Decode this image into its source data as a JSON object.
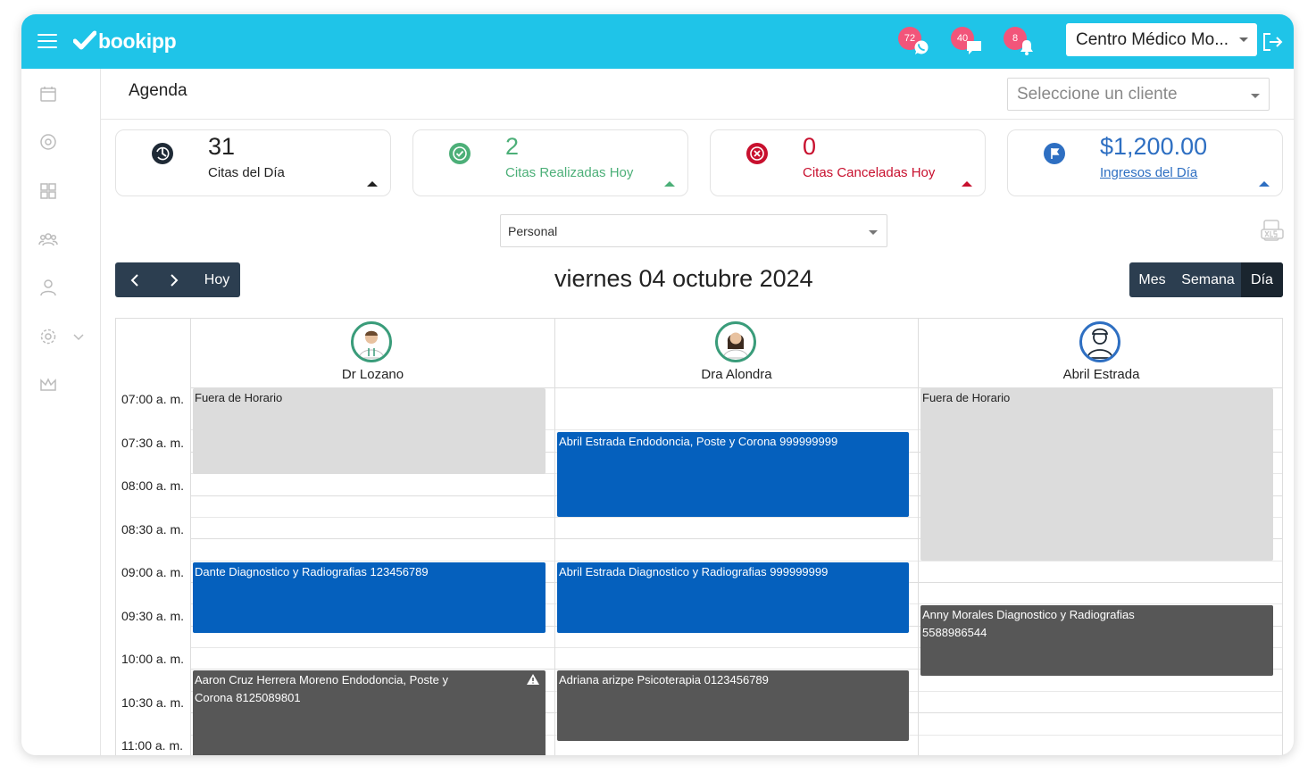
{
  "topbar": {
    "logo": "bookipp",
    "notifications": [
      {
        "count": "72",
        "icon": "whatsapp-icon"
      },
      {
        "count": "40",
        "icon": "chat-icon"
      },
      {
        "count": "8",
        "icon": "bell-icon"
      }
    ],
    "center": "Centro Médico Mo..."
  },
  "header": {
    "title": "Agenda",
    "client_placeholder": "Seleccione un cliente"
  },
  "stats": [
    {
      "value": "31",
      "label": "Citas del Día",
      "color": "#222222"
    },
    {
      "value": "2",
      "label": "Citas Realizadas Hoy",
      "color": "#4caf78"
    },
    {
      "value": "0",
      "label": "Citas Canceladas Hoy",
      "color": "#c8102e"
    },
    {
      "value": "$1,200.00",
      "label": "Ingresos del Día",
      "color": "#2e6fc2"
    }
  ],
  "filter": {
    "personal": "Personal"
  },
  "nav": {
    "today": "Hoy"
  },
  "date_title": "viernes 04 octubre 2024",
  "views": [
    "Mes",
    "Semana",
    "Día"
  ],
  "staff": [
    {
      "name": "Dr Lozano",
      "color": "#3a9c7a"
    },
    {
      "name": "Dra Alondra",
      "color": "#3a9c7a"
    },
    {
      "name": "Abril Estrada",
      "color": "#2e6fc2"
    }
  ],
  "times": [
    "07:00 a. m.",
    "07:30 a. m.",
    "08:00 a. m.",
    "08:30 a. m.",
    "09:00 a. m.",
    "09:30 a. m.",
    "10:00 a. m.",
    "10:30 a. m.",
    "11:00 a. m."
  ],
  "events": {
    "e1": "Fuera de Horario",
    "e2": "Abril Estrada Endodoncia, Poste y Corona 999999999",
    "e3": "Fuera de Horario",
    "e4": "Dante Diagnostico y Radiografias 123456789",
    "e5": "Abril Estrada Diagnostico y Radiografias 999999999",
    "e6": "Anny Morales Diagnostico y Radiografias 5588986544",
    "e7": "Aaron Cruz Herrera Moreno Endodoncia, Poste y Corona 8125089801",
    "e8": "Adriana arizpe Psicoterapia 0123456789"
  },
  "colors": {
    "topbar": "#1fc4e8",
    "event_blue": "#0560bd",
    "event_gray": "#575757",
    "nav_dark": "#2c3e50"
  }
}
